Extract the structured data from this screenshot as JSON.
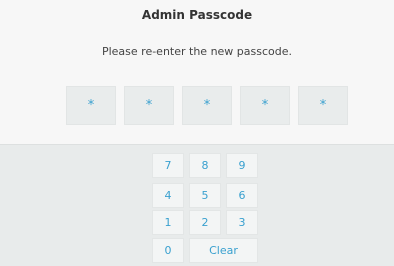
{
  "header": {
    "title": "Admin Passcode"
  },
  "prompt": "Please re-enter the new passcode.",
  "passcode": {
    "mask": [
      "*",
      "*",
      "*",
      "*",
      "*"
    ]
  },
  "keypad": {
    "keys": [
      "7",
      "8",
      "9",
      "4",
      "5",
      "6",
      "1",
      "2",
      "3",
      "0"
    ],
    "clear_label": "Clear"
  },
  "colors": {
    "accent": "#39a0cf",
    "key_bg": "#f3f5f5",
    "pad_bg": "#e8ebeb"
  }
}
